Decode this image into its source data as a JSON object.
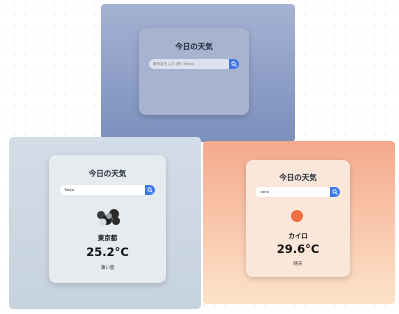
{
  "panels": [
    {
      "title": "今日の天気",
      "search": {
        "value": "",
        "placeholder": "都市名を入力 (例: Tokyo)"
      }
    },
    {
      "title": "今日の天気",
      "search": {
        "value": "Tokyo",
        "placeholder": ""
      },
      "weather": {
        "icon": "cloud-icon",
        "city": "東京都",
        "temperature": "25.2°C",
        "description": "薄い雲"
      }
    },
    {
      "title": "今日の天気",
      "search": {
        "value": "cairo",
        "placeholder": ""
      },
      "weather": {
        "icon": "sun-icon",
        "city": "カイロ",
        "temperature": "29.6°C",
        "description": "晴天"
      }
    }
  ],
  "colors": {
    "button": "#3b78e7",
    "sun": "#ee6f3f",
    "cloud": "#2b2b2b",
    "panel1_gradient": [
      "#a5b2d3",
      "#7b8fbc"
    ],
    "panel2_gradient": [
      "#d3dde7",
      "#c6d2de"
    ],
    "panel3_gradient": [
      "#f4a98d",
      "#fde3c9"
    ]
  }
}
